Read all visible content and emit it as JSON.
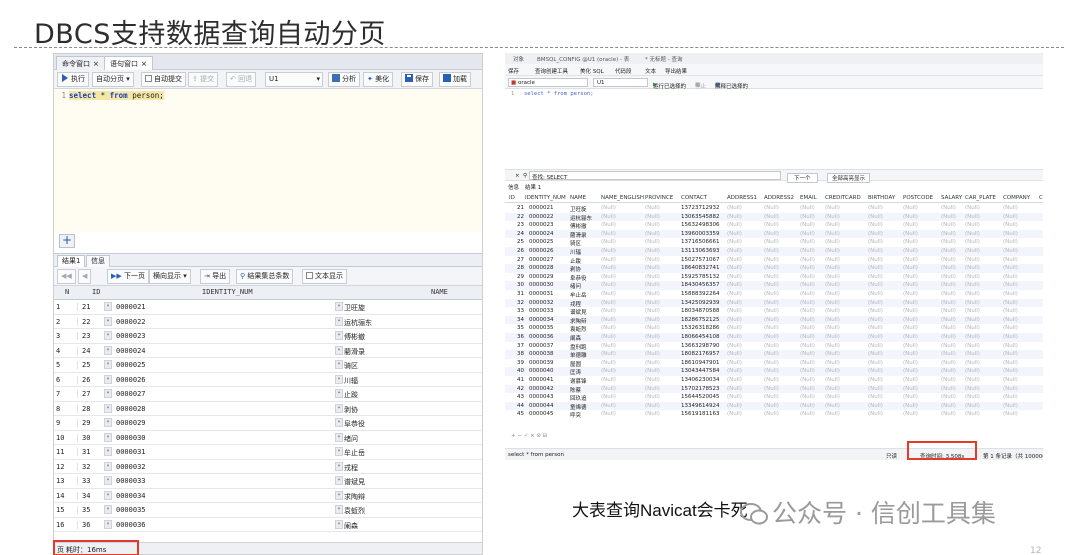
{
  "slide": {
    "title": "DBCS支持数据查询自动分页",
    "caption": "大表查询Navicat会卡死",
    "watermark": "公众号 · 信创工具集",
    "page_number": "12"
  },
  "left_panel": {
    "tabs": [
      "命令窗口",
      "语句窗口"
    ],
    "tab_close": "×",
    "toolbar": {
      "execute": "执行",
      "auto_paging": "自动分页",
      "auto_commit": "自动提交",
      "commit": "提交",
      "rollback": "回退",
      "schema": "U1",
      "analyze": "分析",
      "beautify": "美化",
      "save": "保存",
      "load": "加载"
    },
    "editor": {
      "line": "1",
      "kw_select": "select",
      "star": " * ",
      "kw_from": "from",
      "table": " person;"
    },
    "add_button": "+",
    "result_tabs": [
      "结果1",
      "信息"
    ],
    "nav": {
      "next_page": "下一页",
      "view_mode": "横向显示",
      "export": "导出",
      "total": "结果集总条数",
      "text_view": "文本显示"
    },
    "columns": [
      "N",
      "ID",
      "IDENTITY_NUM",
      "NAME"
    ],
    "rows": [
      {
        "n": "1",
        "id": "21",
        "num": "0000021",
        "name": "卫旺旋"
      },
      {
        "n": "2",
        "id": "22",
        "num": "0000022",
        "name": "运杭骊东"
      },
      {
        "n": "3",
        "id": "23",
        "num": "0000023",
        "name": "傅彬撤"
      },
      {
        "n": "4",
        "id": "24",
        "num": "0000024",
        "name": "藺滑录"
      },
      {
        "n": "5",
        "id": "25",
        "num": "0000025",
        "name": "骑区"
      },
      {
        "n": "6",
        "id": "26",
        "num": "0000026",
        "name": "川辐"
      },
      {
        "n": "7",
        "id": "27",
        "num": "0000027",
        "name": "止踆"
      },
      {
        "n": "8",
        "id": "28",
        "num": "0000028",
        "name": "剥协"
      },
      {
        "n": "9",
        "id": "29",
        "num": "0000029",
        "name": "阜恭役"
      },
      {
        "n": "10",
        "id": "30",
        "num": "0000030",
        "name": "绪问"
      },
      {
        "n": "11",
        "id": "31",
        "num": "0000031",
        "name": "牟止岳"
      },
      {
        "n": "12",
        "id": "32",
        "num": "0000032",
        "name": "戎程"
      },
      {
        "n": "13",
        "id": "33",
        "num": "0000033",
        "name": "谱斌見"
      },
      {
        "n": "14",
        "id": "34",
        "num": "0000034",
        "name": "求陶辩"
      },
      {
        "n": "15",
        "id": "35",
        "num": "0000035",
        "name": "袁蚯烈"
      },
      {
        "n": "16",
        "id": "36",
        "num": "0000036",
        "name": "阑森"
      }
    ],
    "status_prefix": "页",
    "elapsed": "耗时：16ms"
  },
  "right_panel": {
    "titlebar": [
      "对象",
      "BMSQL_CONFIG @U1 (oracle) - 表",
      "* 无标题 - 查询"
    ],
    "toolbar2": [
      "保存",
      "查询创建工具",
      "美化 SQL",
      "代码段",
      "文本",
      "导出结果"
    ],
    "toolbar3": {
      "connection": "oracle",
      "schema": "U1",
      "run": "运行已选择的",
      "stop": "停止",
      "explain": "解释已选择的"
    },
    "editor": {
      "line": "1",
      "sql": "select * from person;"
    },
    "findbar": {
      "query": "查找: SELECT",
      "next": "下一个",
      "select_all": "全部高亮显示"
    },
    "tabs": [
      "信息",
      "结果 1"
    ],
    "columns": [
      "ID",
      "IDENTITY_NUM",
      "NAME",
      "NAME_ENGLISH",
      "PROVINCE",
      "CONTACT",
      "ADDRESS1",
      "ADDRESS2",
      "EMAIL",
      "CREDITCARD",
      "BIRTHDAY",
      "POSTCODE",
      "SALARY",
      "CAR_PLATE",
      "COMPANY",
      "C"
    ],
    "null_text": "(Null)",
    "rows": [
      {
        "id": "21",
        "num": "0000021",
        "name": "卫旺旋",
        "contact": "13723712932"
      },
      {
        "id": "22",
        "num": "0000022",
        "name": "运杭骊东",
        "contact": "13063545882"
      },
      {
        "id": "23",
        "num": "0000023",
        "name": "傅彬撤",
        "contact": "15632498306"
      },
      {
        "id": "24",
        "num": "0000024",
        "name": "藺滑录",
        "contact": "13960003359"
      },
      {
        "id": "25",
        "num": "0000025",
        "name": "骑区",
        "contact": "13716506661"
      },
      {
        "id": "26",
        "num": "0000026",
        "name": "川辐",
        "contact": "13113063693"
      },
      {
        "id": "27",
        "num": "0000027",
        "name": "止踆",
        "contact": "15027571067"
      },
      {
        "id": "28",
        "num": "0000028",
        "name": "剥协",
        "contact": "18640832741"
      },
      {
        "id": "29",
        "num": "0000029",
        "name": "阜恭役",
        "contact": "15925785132"
      },
      {
        "id": "30",
        "num": "0000030",
        "name": "绪问",
        "contact": "18430456357"
      },
      {
        "id": "31",
        "num": "0000031",
        "name": "牟止岳",
        "contact": "15888392264"
      },
      {
        "id": "32",
        "num": "0000032",
        "name": "戎程",
        "contact": "13425092939"
      },
      {
        "id": "33",
        "num": "0000033",
        "name": "谱斌見",
        "contact": "18034870588"
      },
      {
        "id": "34",
        "num": "0000034",
        "name": "求陶辩",
        "contact": "18286752125"
      },
      {
        "id": "35",
        "num": "0000035",
        "name": "袁蚯烈",
        "contact": "15326318286"
      },
      {
        "id": "36",
        "num": "0000036",
        "name": "阑森",
        "contact": "18066454108"
      },
      {
        "id": "37",
        "num": "0000037",
        "name": "盘刑跑",
        "contact": "13663298790"
      },
      {
        "id": "38",
        "num": "0000038",
        "name": "单德雕",
        "contact": "18082176957"
      },
      {
        "id": "39",
        "num": "0000039",
        "name": "屋圆",
        "contact": "18610947901"
      },
      {
        "id": "40",
        "num": "0000040",
        "name": "匡涛",
        "contact": "13043447584"
      },
      {
        "id": "41",
        "num": "0000041",
        "name": "谢慕锋",
        "contact": "13406230034"
      },
      {
        "id": "42",
        "num": "0000042",
        "name": "陈蔡",
        "contact": "15702178523"
      },
      {
        "id": "43",
        "num": "0000043",
        "name": "回玖追",
        "contact": "15644520045"
      },
      {
        "id": "44",
        "num": "0000044",
        "name": "童烯德",
        "contact": "13349614924"
      },
      {
        "id": "45",
        "num": "0000045",
        "name": "呼突",
        "contact": "15619181163"
      }
    ],
    "bottom_controls": "+ − ✓ × ⊘ ⊟",
    "status_sql": "select * from person",
    "status_mode": "只读",
    "elapsed": "查询时间: 3.508s",
    "record_info": "第 1 条记录（共 100000"
  },
  "colors": {
    "highlight_box": "#e23b2a",
    "keyword": "#1a3fc0",
    "toolbar_bg": "#f1f3f6"
  }
}
